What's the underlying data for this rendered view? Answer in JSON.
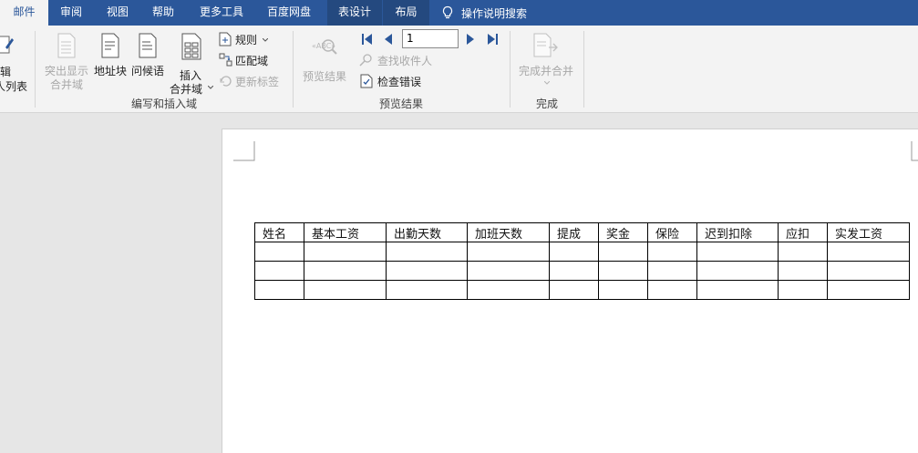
{
  "tabs": [
    {
      "label": "邮件",
      "active": true
    },
    {
      "label": "审阅"
    },
    {
      "label": "视图"
    },
    {
      "label": "帮助"
    },
    {
      "label": "更多工具"
    },
    {
      "label": "百度网盘"
    },
    {
      "label": "表设计",
      "contextual": true
    },
    {
      "label": "布局",
      "contextual": true
    }
  ],
  "tell_me": {
    "label": "操作说明搜索",
    "icon": "lightbulb-icon"
  },
  "ribbon": {
    "partial": {
      "line1": "辑",
      "line2": "人列表"
    },
    "write_insert": {
      "group_label": "编写和插入域",
      "highlight_line1": "突出显示",
      "highlight_line2": "合并域",
      "address_block": "地址块",
      "greeting_line": "问候语",
      "insert_field_line1": "插入",
      "insert_field_line2": "合并域",
      "rules": "规则",
      "match_fields": "匹配域",
      "update_labels": "更新标签"
    },
    "preview": {
      "group_label": "预览结果",
      "preview_results": "预览结果",
      "record_number": "1",
      "find_recipient": "查找收件人",
      "check_errors": "检查错误"
    },
    "finish": {
      "group_label": "完成",
      "finish_merge": "完成并合并"
    }
  },
  "colors": {
    "accent": "#2b579a",
    "ribbon_bg": "#f3f3f3",
    "disabled_text": "#a8a8a8"
  },
  "table": {
    "headers": [
      "姓名",
      "基本工资",
      "出勤天数",
      "加班天数",
      "提成",
      "奖金",
      "保险",
      "迟到扣除",
      "应扣",
      "实发工资"
    ],
    "rows": [
      [
        "",
        "",
        "",
        "",
        "",
        "",
        "",
        "",
        "",
        ""
      ],
      [
        "",
        "",
        "",
        "",
        "",
        "",
        "",
        "",
        "",
        ""
      ],
      [
        "",
        "",
        "",
        "",
        "",
        "",
        "",
        "",
        "",
        ""
      ]
    ]
  }
}
